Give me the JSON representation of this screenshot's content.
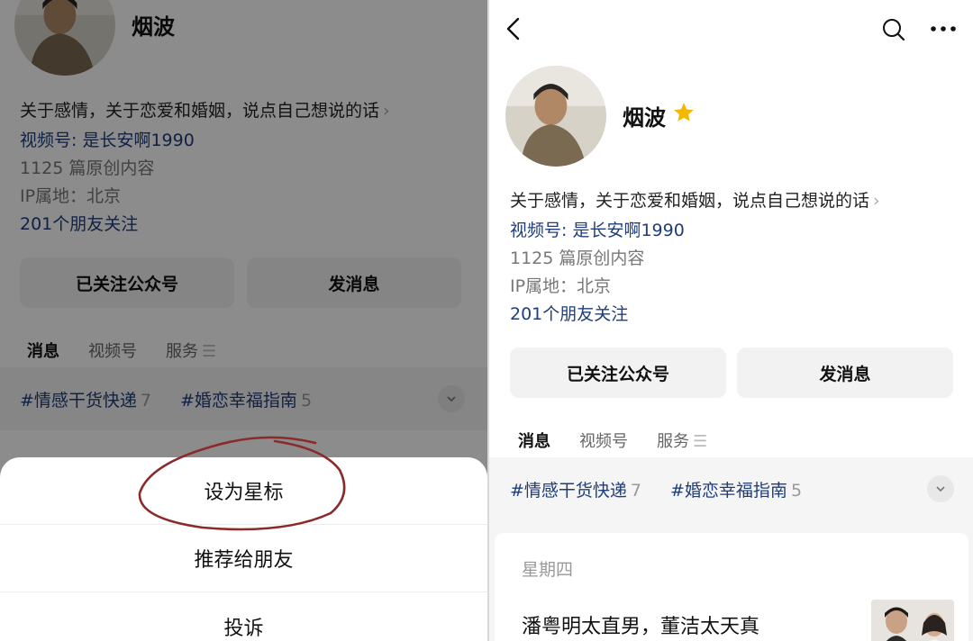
{
  "profile": {
    "name": "烟波",
    "bio": "关于感情，关于恋爱和婚姻，说点自己想说的话",
    "bio_chevron": "›",
    "channel": "视频号: 是长安啊1990",
    "articles": "1125 篇原创内容",
    "ip": "IP属地：北京",
    "friends": "201个朋友关注"
  },
  "buttons": {
    "followed": "已关注公众号",
    "message": "发消息"
  },
  "tabs": {
    "messages": "消息",
    "channel": "视频号",
    "services": "服务",
    "services_menu": "☰"
  },
  "tags": [
    {
      "label": "#情感干货快递",
      "count": "7"
    },
    {
      "label": "#婚恋幸福指南",
      "count": "5"
    }
  ],
  "sheet": {
    "star": "设为星标",
    "recommend": "推荐给朋友",
    "report": "投诉"
  },
  "feed": {
    "day": "星期四",
    "headline": "潘粤明太直男，董洁太天真"
  },
  "colors": {
    "link": "#1f3d7a",
    "star": "#f5b800",
    "annotation": "#8b2a2a"
  }
}
